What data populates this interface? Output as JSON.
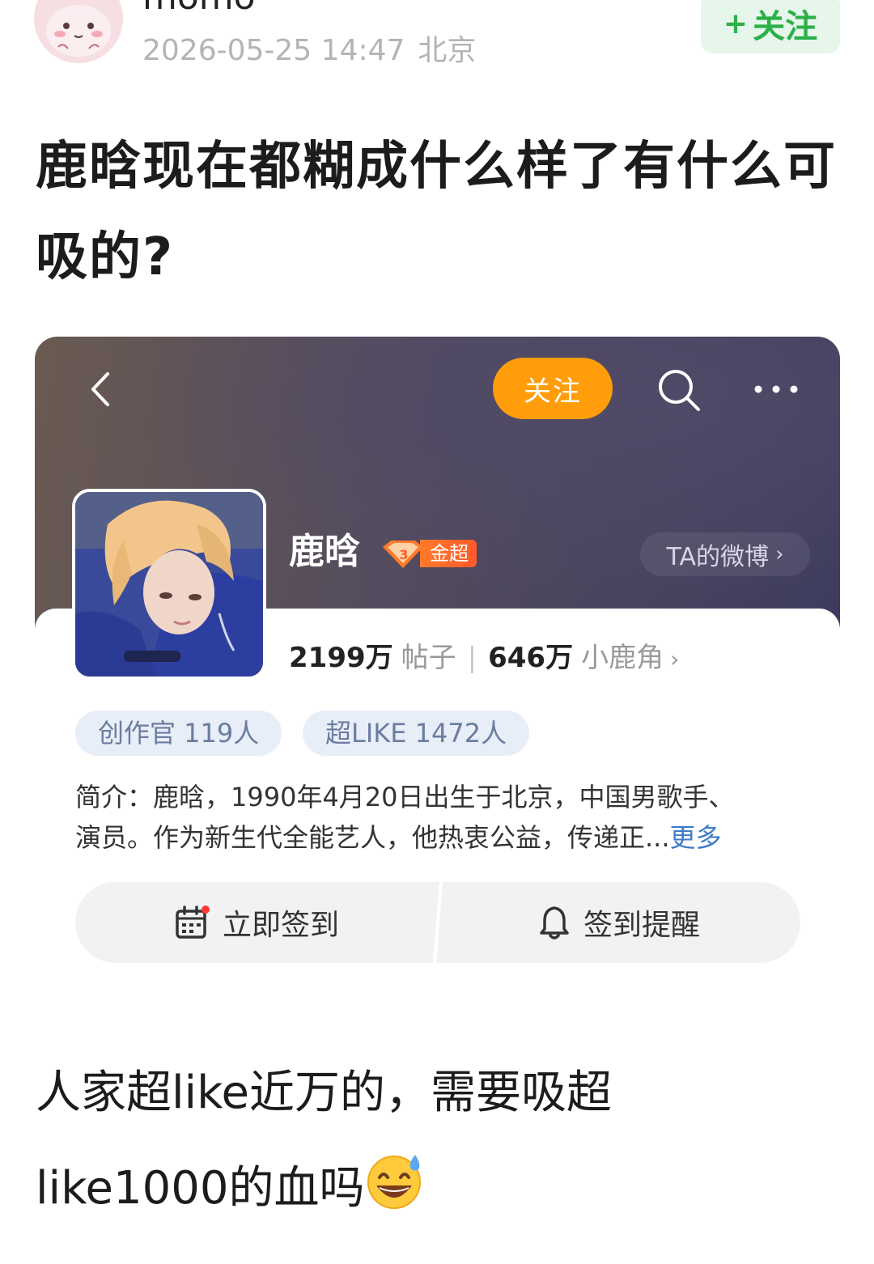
{
  "post": {
    "username": "momo",
    "date": "2026-05-25 14:47",
    "location": "北京",
    "follow_plus": "+",
    "follow_label": "关注",
    "title": "鹿晗现在都糊成什么样了有什么可吸的?",
    "body_line1": "人家超like近万的，需要吸超",
    "body_line2": "like1000的血吗",
    "emoji": "grinning-face-with-sweat-icon"
  },
  "card": {
    "follow_label": "关注",
    "name": "鹿晗",
    "badge_number": "3",
    "badge_label": "金超",
    "weibo_link": "TA的微博",
    "posts_count": "2199万",
    "posts_label": "帖子",
    "separator": "|",
    "fans_count": "646万",
    "fans_label": "小鹿角",
    "tag_creator": "创作官 119人",
    "tag_superlike": "超LIKE 1472人",
    "intro_line1": "简介：鹿晗，1990年4月20日出生于北京，中国男歌手、",
    "intro_line2": "演员。作为新生代全能艺人，他热衷公益，传递正...",
    "intro_more": "更多",
    "checkin_label": "立即签到",
    "reminder_label": "签到提醒"
  },
  "colors": {
    "follow_green": "#2bb04a",
    "follow_orange": "#ff9d0a",
    "badge_orange": "#ff6a2a",
    "link_blue": "#3e7bc8"
  }
}
